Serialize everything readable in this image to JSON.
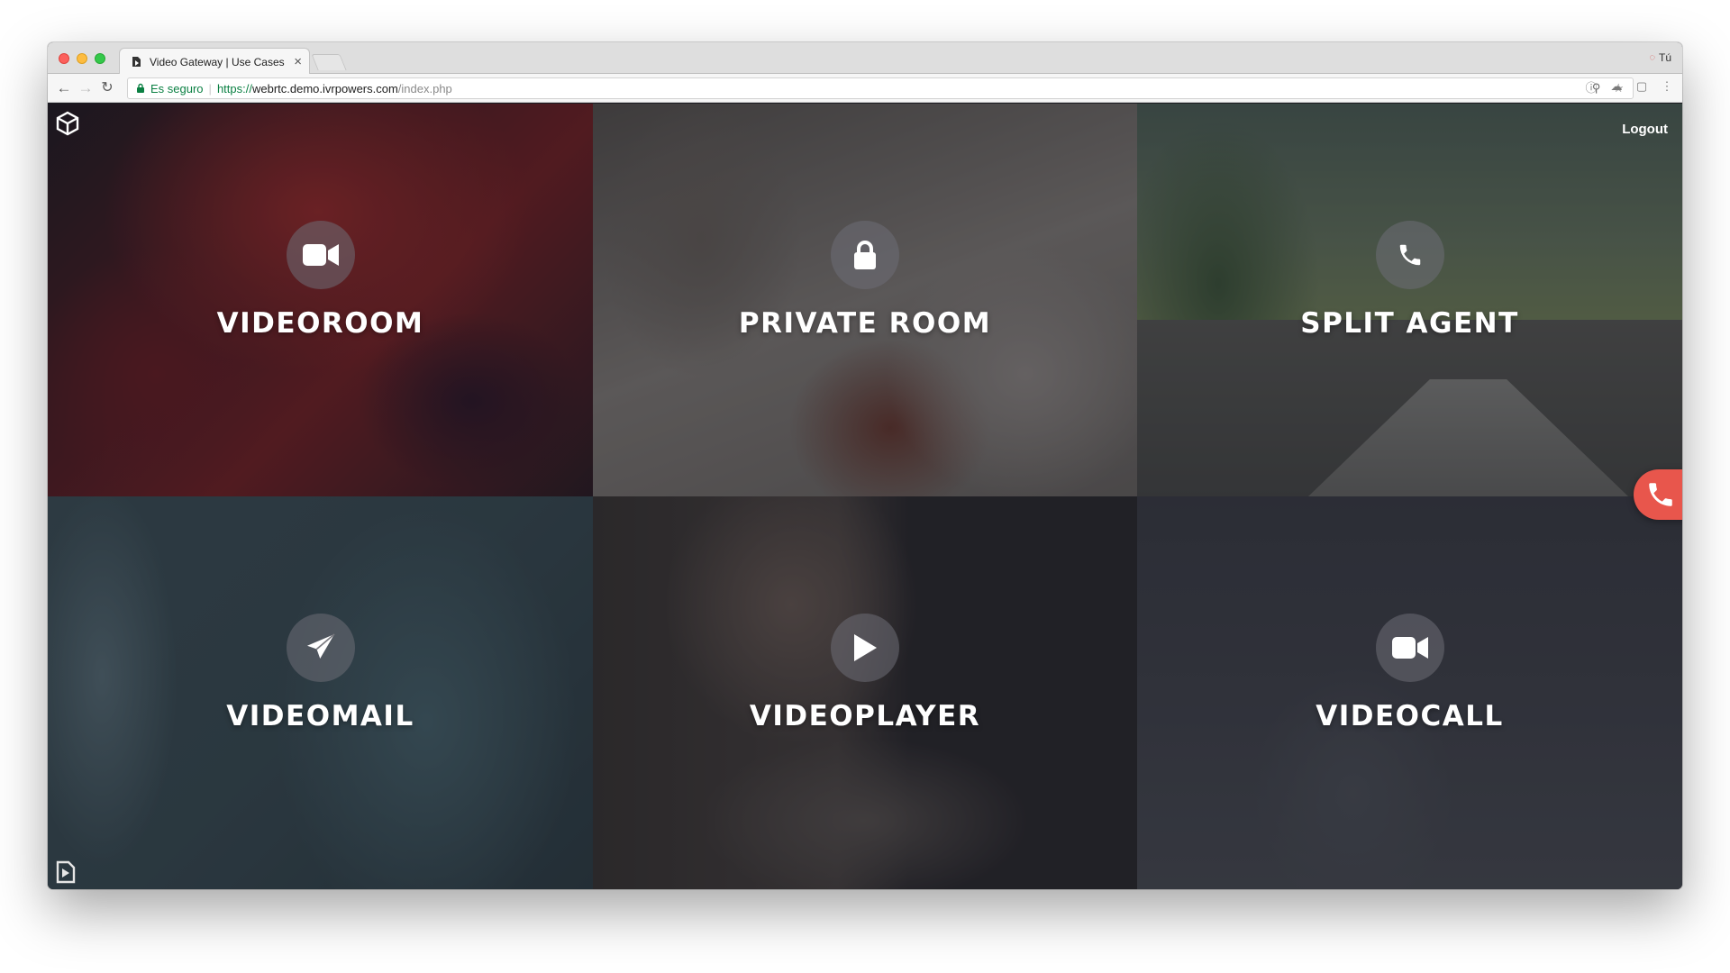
{
  "browser": {
    "tab_title": "Video Gateway | Use Cases",
    "tab_close": "×",
    "profile_label": "Tú",
    "security_label": "Es seguro",
    "url_scheme": "https://",
    "url_host": "webrtc.demo.ivrpowers.com",
    "url_path": "/index.php",
    "nav": {
      "back": "←",
      "forward": "→",
      "reload": "↻"
    }
  },
  "page": {
    "logout_label": "Logout",
    "tiles": [
      {
        "label": "VIDEOROOM",
        "icon": "video-camera-icon"
      },
      {
        "label": "PRIVATE ROOM",
        "icon": "lock-icon"
      },
      {
        "label": "SPLIT AGENT",
        "icon": "phone-icon"
      },
      {
        "label": "VIDEOMAIL",
        "icon": "paper-plane-icon"
      },
      {
        "label": "VIDEOPLAYER",
        "icon": "play-icon"
      },
      {
        "label": "VIDEOCALL",
        "icon": "video-camera-icon"
      }
    ]
  },
  "colors": {
    "secure_green": "#0b8043",
    "call_button": "#e8564c",
    "label_white": "#ffffff"
  }
}
